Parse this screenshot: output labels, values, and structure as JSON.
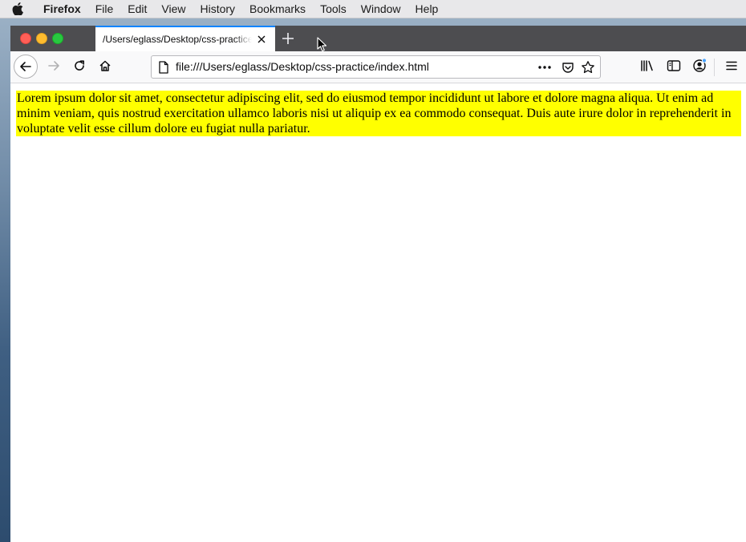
{
  "menubar": {
    "app": "Firefox",
    "items": [
      "File",
      "Edit",
      "View",
      "History",
      "Bookmarks",
      "Tools",
      "Window",
      "Help"
    ]
  },
  "tab": {
    "title": "/Users/eglass/Desktop/css-practice/index.html"
  },
  "urlbar": {
    "value": "file:///Users/eglass/Desktop/css-practice/index.html"
  },
  "page": {
    "paragraph": "Lorem ipsum dolor sit amet, consectetur adipiscing elit, sed do eiusmod tempor incididunt ut labore et dolore magna aliqua. Ut enim ad minim veniam, quis nostrud exercitation ullamco laboris nisi ut aliquip ex ea commodo consequat. Duis aute irure dolor in reprehenderit in voluptate velit esse cillum dolore eu fugiat nulla pariatur."
  },
  "colors": {
    "highlight": "#ffff00",
    "tab_accent": "#0a84ff",
    "tabbar": "#4d4d50"
  }
}
